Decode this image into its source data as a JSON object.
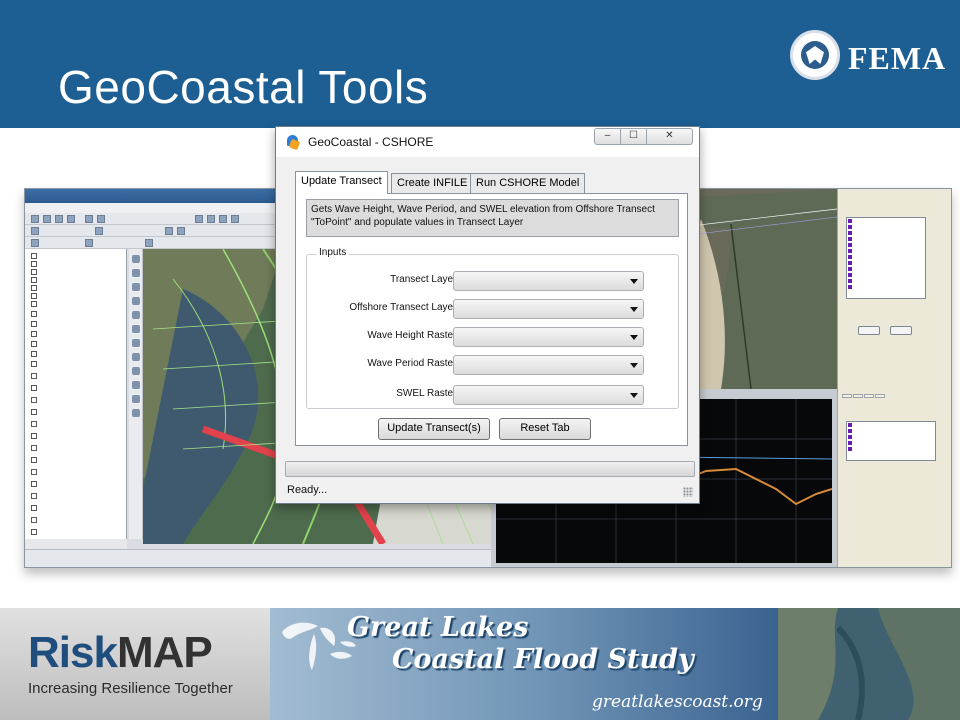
{
  "slide": {
    "title": "GeoCoastal Tools",
    "agency": "FEMA",
    "agency_seal_name": "dhs-seal"
  },
  "dialog": {
    "title": "GeoCoastal - CSHORE",
    "tabs": [
      {
        "label": "Update Transect",
        "active": true
      },
      {
        "label": "Create INFILE",
        "active": false
      },
      {
        "label": "Run CSHORE Model",
        "active": false
      }
    ],
    "description": "Gets Wave Height, Wave Period, and SWEL elevation from Offshore Transect \"ToPoint\" and populate values in Transect Layer",
    "inputs_group_label": "Inputs",
    "fields": [
      {
        "label": "Transect Layer :",
        "value": ""
      },
      {
        "label": "Offshore Transect Layer :",
        "value": ""
      },
      {
        "label": "Wave Height Raster :",
        "value": ""
      },
      {
        "label": "Wave Period Raster :",
        "value": ""
      },
      {
        "label": "SWEL Raster :",
        "value": ""
      }
    ],
    "buttons": {
      "update": "Update Transect(s)",
      "reset": "Reset Tab"
    },
    "status": "Ready...",
    "window_controls": {
      "minimize": "–",
      "maximize": "☐",
      "close": "✕"
    }
  },
  "footer": {
    "riskmap_brand_a": "Risk",
    "riskmap_brand_b": "MAP",
    "riskmap_tagline": "Increasing Resilience Together",
    "study_title_line1": "Great Lakes",
    "study_title_line2": "Coastal Flood Study",
    "study_url": "greatlakescoast.org"
  },
  "colors": {
    "header_blue": "#1d5e93",
    "riskmap_blue": "#1f4d7d",
    "dialog_bg": "#f0f0f0"
  }
}
